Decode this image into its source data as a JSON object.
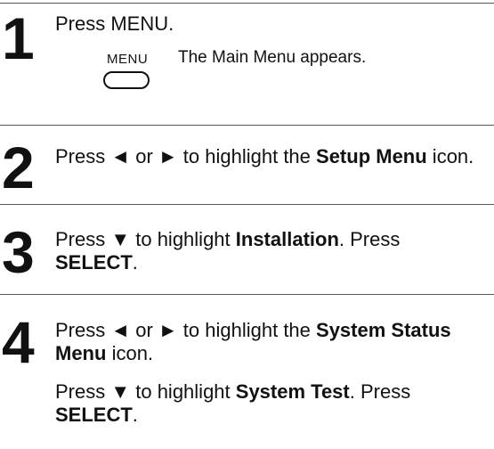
{
  "steps": [
    {
      "number": "1",
      "text": "Press MENU.",
      "button_label": "MENU",
      "note": "The Main Menu appears."
    },
    {
      "number": "2",
      "pre": "Press ◄ or ► to highlight the ",
      "bold": "Setup Menu",
      "post": " icon."
    },
    {
      "number": "3",
      "pre": "Press ▼ to highlight ",
      "bold1": "Installation",
      "mid": ".  Press ",
      "bold2": "SELECT",
      "post": "."
    },
    {
      "number": "4",
      "pre": "Press ◄ or ► to highlight the ",
      "bold": "System Status Menu",
      "post": " icon.",
      "sub_pre": "Press ▼ to highlight ",
      "sub_bold1": "System Test",
      "sub_mid": ".  Press ",
      "sub_bold2": "SELECT",
      "sub_post": "."
    }
  ]
}
